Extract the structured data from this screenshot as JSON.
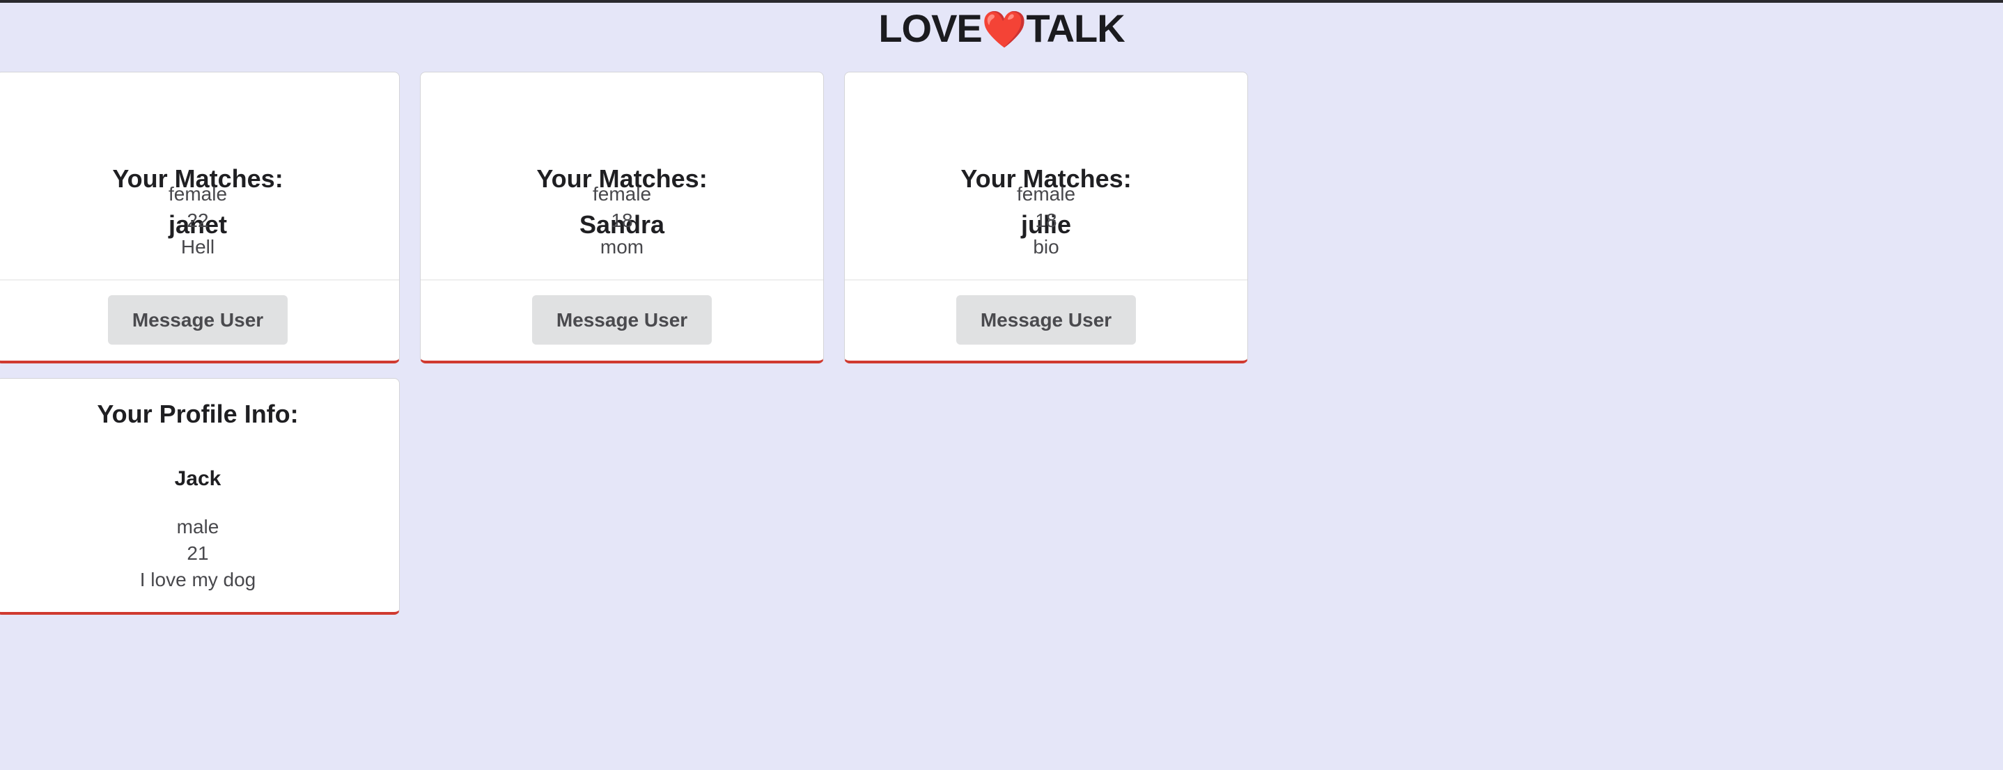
{
  "header": {
    "title_left": "LOVE",
    "heart": "❤️",
    "title_right": "TALK"
  },
  "matches": [
    {
      "heading": "Your Matches:",
      "name": "janet",
      "gender": "female",
      "age": "22",
      "bio": "Hell",
      "button": "Message User"
    },
    {
      "heading": "Your Matches:",
      "name": "Sandra",
      "gender": "female",
      "age": "18",
      "bio": "mom",
      "button": "Message User"
    },
    {
      "heading": "Your Matches:",
      "name": "julie",
      "gender": "female",
      "age": "18",
      "bio": "bio",
      "button": "Message User"
    }
  ],
  "profile": {
    "heading": "Your Profile Info:",
    "name": "Jack",
    "gender": "male",
    "age": "21",
    "bio": "I love my dog"
  },
  "colors": {
    "background": "#e5e6f8",
    "accent": "#d03a30"
  }
}
